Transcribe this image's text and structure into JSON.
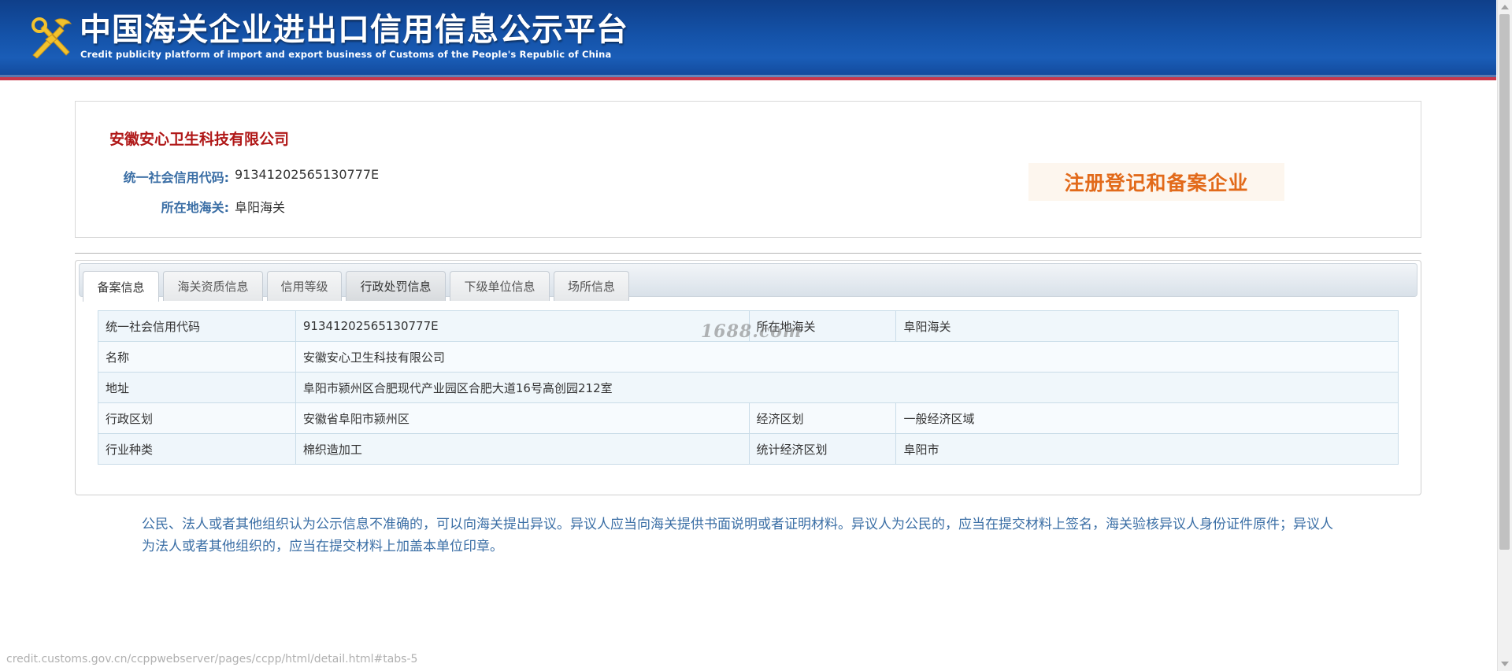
{
  "header": {
    "title": "中国海关企业进出口信用信息公示平台",
    "subtitle": "Credit publicity platform of import and export business of Customs of the People's Republic of China",
    "logo_icon": "customs-emblem-icon"
  },
  "company": {
    "name": "安徽安心卫生科技有限公司",
    "credit_code_label": "统一社会信用代码:",
    "credit_code": "91341202565130777E",
    "customs_label": "所在地海关:",
    "customs": "阜阳海关",
    "stamp_text": "注册登记和备案企业"
  },
  "tabs": [
    {
      "label": "备案信息",
      "active": true
    },
    {
      "label": "海关资质信息",
      "active": false
    },
    {
      "label": "信用等级",
      "active": false
    },
    {
      "label": "行政处罚信息",
      "active": false
    },
    {
      "label": "下级单位信息",
      "active": false
    },
    {
      "label": "场所信息",
      "active": false
    }
  ],
  "details": {
    "row1": {
      "label1": "统一社会信用代码",
      "value1": "91341202565130777E",
      "label2": "所在地海关",
      "value2": "阜阳海关"
    },
    "row2": {
      "label1": "名称",
      "value1": "安徽安心卫生科技有限公司"
    },
    "row3": {
      "label1": "地址",
      "value1": "阜阳市颍州区合肥现代产业园区合肥大道16号高创园212室"
    },
    "row4": {
      "label1": "行政区划",
      "value1": "安徽省阜阳市颍州区",
      "label2": "经济区划",
      "value2": "一般经济区域"
    },
    "row5": {
      "label1": "行业种类",
      "value1": "棉织造加工",
      "label2": "统计经济区划",
      "value2": "阜阳市"
    }
  },
  "watermark": "1688.com",
  "notice": "公民、法人或者其他组织认为公示信息不准确的，可以向海关提出异议。异议人应当向海关提供书面说明或者证明材料。异议人为公民的，应当在提交材料上签名，海关验核异议人身份证件原件；异议人为法人或者其他组织的，应当在提交材料上加盖本单位印章。",
  "status_bar": {
    "url": "credit.customs.gov.cn/ccppwebserver/pages/ccpp/html/detail.html#tabs-5"
  },
  "colors": {
    "banner": "#1452a8",
    "banner_stripe": "#c8374a",
    "company_name": "#b01818",
    "label_blue": "#3a6ea5",
    "stamp_orange": "#e26a1a"
  }
}
